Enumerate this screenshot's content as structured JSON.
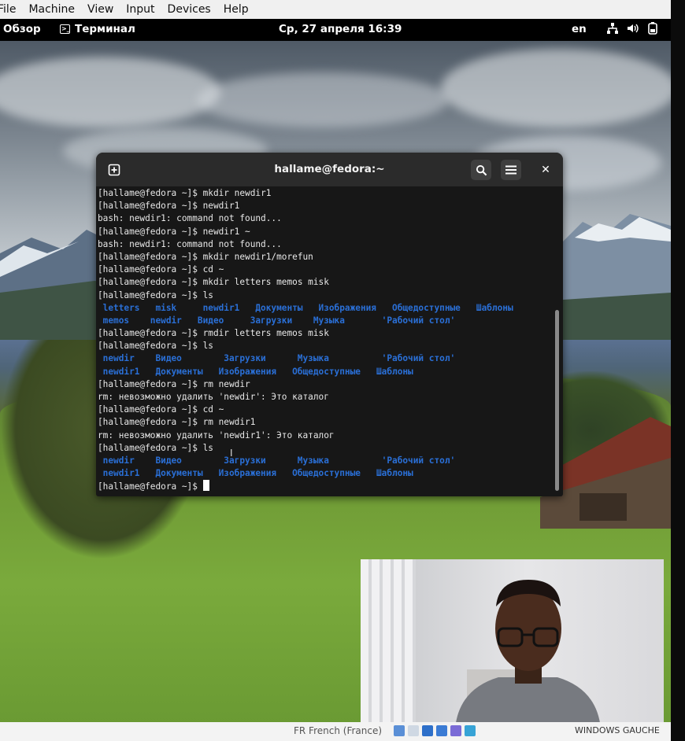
{
  "host_menu": [
    "File",
    "Machine",
    "View",
    "Input",
    "Devices",
    "Help"
  ],
  "gnome_bar": {
    "activities": "Обзор",
    "app_name": "Терминал",
    "clock": "Ср, 27 апреля  16:39",
    "lang": "en",
    "system_icons": [
      "network-icon",
      "volume-icon",
      "battery-icon"
    ]
  },
  "terminal": {
    "title": "hallame@fedora:~",
    "prompt": "[hallame@fedora ~]$ ",
    "lines": [
      {
        "type": "cmd",
        "text": "mkdir newdir1"
      },
      {
        "type": "cmd",
        "text": "newdir1"
      },
      {
        "type": "out",
        "text": "bash: newdir1: command not found..."
      },
      {
        "type": "cmd",
        "text": "newdir1 ~"
      },
      {
        "type": "out",
        "text": "bash: newdir1: command not found..."
      },
      {
        "type": "cmd",
        "text": "mkdir newdir1/morefun"
      },
      {
        "type": "cmd",
        "text": "cd ~"
      },
      {
        "type": "cmd",
        "text": "mkdir letters memos misk"
      },
      {
        "type": "cmd",
        "text": "ls"
      },
      {
        "type": "ls",
        "text": " letters   misk     newdir1   Документы   Изображения   Общедоступные   Шаблоны"
      },
      {
        "type": "ls",
        "text": " memos    newdir   Видео     Загрузки    Музыка       'Рабочий стол'"
      },
      {
        "type": "cmd",
        "text": "rmdir letters memos misk"
      },
      {
        "type": "cmd",
        "text": "ls"
      },
      {
        "type": "ls",
        "text": " newdir    Видео        Загрузки      Музыка          'Рабочий стол'"
      },
      {
        "type": "ls",
        "text": " newdir1   Документы   Изображения   Общедоступные   Шаблоны"
      },
      {
        "type": "cmd",
        "text": "rm newdir"
      },
      {
        "type": "out",
        "text": "rm: невозможно удалить 'newdir': Это каталог"
      },
      {
        "type": "cmd",
        "text": "cd ~"
      },
      {
        "type": "cmd",
        "text": "rm newdir1"
      },
      {
        "type": "out",
        "text": "rm: невозможно удалить 'newdir1': Это каталог"
      },
      {
        "type": "cmd",
        "text": "ls"
      },
      {
        "type": "ls",
        "text": " newdir    Видео        Загрузки      Музыка          'Рабочий стол'"
      },
      {
        "type": "ls",
        "text": " newdir1   Документы   Изображения   Общедоступные   Шаблоны"
      },
      {
        "type": "prompt",
        "text": ""
      }
    ]
  },
  "host_taskbar": {
    "keyboard": "FR French (France)",
    "window_group": "WINDOWS GAUCHE"
  },
  "colors": {
    "ls_dir": "#2a6fd6",
    "term_bg": "#171717",
    "term_header": "#2b2b2b"
  }
}
